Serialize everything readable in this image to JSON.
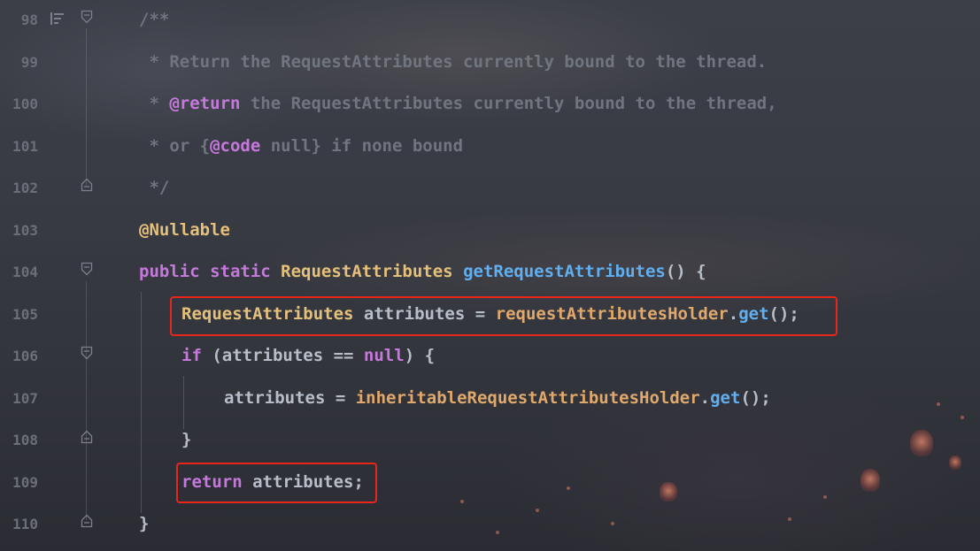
{
  "editor": {
    "lines": [
      {
        "number": "98",
        "tokens": [
          {
            "cls": "c-comment",
            "text": "/**"
          }
        ]
      },
      {
        "number": "99",
        "tokens": [
          {
            "cls": "c-comment",
            "text": " * Return the RequestAttributes currently bound to the thread."
          }
        ]
      },
      {
        "number": "100",
        "tokens": [
          {
            "cls": "c-comment",
            "text": " * "
          },
          {
            "cls": "c-doctag",
            "text": "@return"
          },
          {
            "cls": "c-comment",
            "text": " the RequestAttributes currently bound to the thread,"
          }
        ]
      },
      {
        "number": "101",
        "tokens": [
          {
            "cls": "c-comment",
            "text": " * or {"
          },
          {
            "cls": "c-doctag",
            "text": "@code"
          },
          {
            "cls": "c-comment",
            "text": " null} if none bound"
          }
        ]
      },
      {
        "number": "102",
        "tokens": [
          {
            "cls": "c-comment",
            "text": " */"
          }
        ]
      },
      {
        "number": "103",
        "tokens": [
          {
            "cls": "c-annot",
            "text": "@Nullable"
          }
        ]
      },
      {
        "number": "104",
        "tokens": [
          {
            "cls": "c-keyword",
            "text": "public static "
          },
          {
            "cls": "c-type",
            "text": "RequestAttributes "
          },
          {
            "cls": "c-func",
            "text": "getRequestAttributes"
          },
          {
            "cls": "c-plain",
            "text": "() {"
          }
        ]
      },
      {
        "number": "105",
        "tokens": [
          {
            "cls": "c-type",
            "text": "RequestAttributes "
          },
          {
            "cls": "c-plain",
            "text": "attributes = "
          },
          {
            "cls": "c-field",
            "text": "requestAttributesHolder"
          },
          {
            "cls": "c-plain",
            "text": "."
          },
          {
            "cls": "c-func",
            "text": "get"
          },
          {
            "cls": "c-plain",
            "text": "();"
          }
        ]
      },
      {
        "number": "106",
        "tokens": [
          {
            "cls": "c-keyword",
            "text": "if "
          },
          {
            "cls": "c-plain",
            "text": "(attributes == "
          },
          {
            "cls": "c-keyword",
            "text": "null"
          },
          {
            "cls": "c-plain",
            "text": ") {"
          }
        ]
      },
      {
        "number": "107",
        "tokens": [
          {
            "cls": "c-plain",
            "text": "attributes = "
          },
          {
            "cls": "c-field",
            "text": "inheritableRequestAttributesHolder"
          },
          {
            "cls": "c-plain",
            "text": "."
          },
          {
            "cls": "c-func",
            "text": "get"
          },
          {
            "cls": "c-plain",
            "text": "();"
          }
        ]
      },
      {
        "number": "108",
        "tokens": [
          {
            "cls": "c-plain",
            "text": "}"
          }
        ]
      },
      {
        "number": "109",
        "tokens": [
          {
            "cls": "c-keyword",
            "text": "return "
          },
          {
            "cls": "c-plain",
            "text": "attributes;"
          }
        ]
      },
      {
        "number": "110",
        "tokens": [
          {
            "cls": "c-plain",
            "text": "}"
          }
        ]
      }
    ]
  },
  "colors": {
    "comment": "#70757f",
    "keyword": "#c678dd",
    "type": "#e5c07b",
    "function": "#61afef",
    "field": "#e0a86b",
    "plain": "#b8bec8",
    "highlight_border": "#e8261b"
  },
  "icons": {
    "gutter_bookmark": "bookmark-lines-icon",
    "fold_open": "fold-open-icon",
    "fold_close": "fold-close-icon"
  }
}
